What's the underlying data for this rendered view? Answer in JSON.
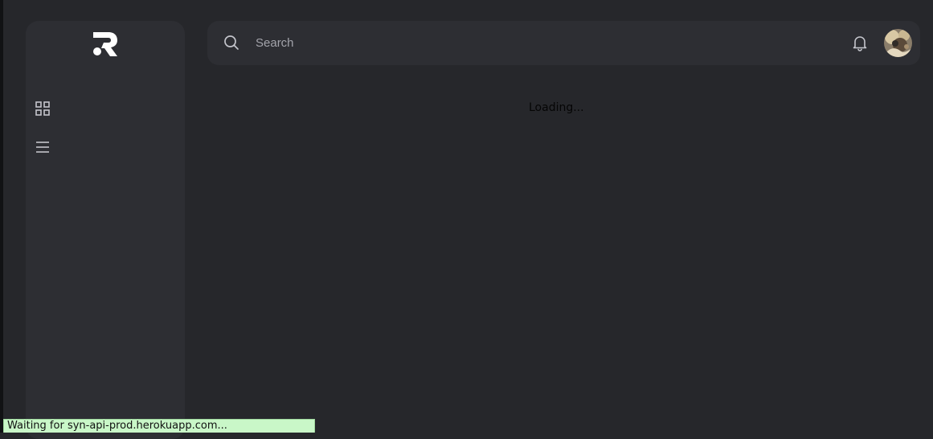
{
  "search": {
    "placeholder": "Search"
  },
  "main": {
    "loading_text": "Loading..."
  },
  "browser_status": {
    "text": "Waiting for syn-api-prod.herokuapp.com..."
  },
  "icons": {
    "logo": "r-logo",
    "nav_dashboard": "grid-icon",
    "nav_menu": "menu-icon",
    "search": "search-icon",
    "notifications": "bell-icon"
  },
  "colors": {
    "background": "#26272b",
    "panel": "#2d2e33",
    "icon": "#c4c5cc",
    "status_bar": "#c9f7c8"
  }
}
